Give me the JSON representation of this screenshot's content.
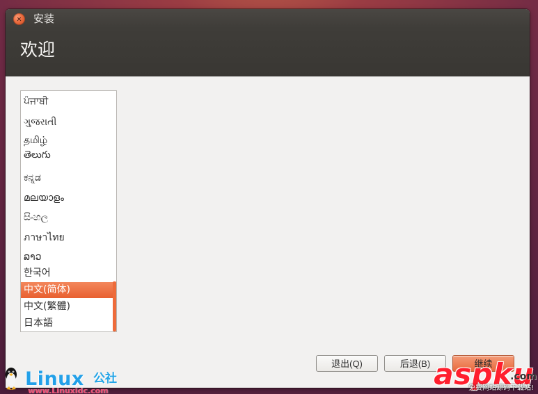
{
  "window": {
    "title": "安装",
    "page_title": "欢迎"
  },
  "languages": {
    "items": [
      "ਪੰਜਾਬੀ",
      "ગુજરાતી",
      "தமிழ்",
      "తెలుగు",
      "ಕನ್ನಡ",
      "മലയാളം",
      "සිංහල",
      "ภาษาไทย",
      "ລາວ",
      "한국어",
      "中文(简体)",
      "中文(繁體)",
      "日本語"
    ],
    "selected": "中文(简体)"
  },
  "buttons": {
    "quit": "退出(Q)",
    "back": "后退(B)",
    "next": "继续"
  },
  "watermarks": {
    "left_brand": "Linux",
    "left_brand_cn": "公社",
    "left_url": "www.Linuxidc.com",
    "right_brand": "aspku",
    "right_tld": ".com",
    "right_sub": "免费网站源码下载站!"
  },
  "colors": {
    "accent": "#e85f2f",
    "title_bar": "#3f3d39",
    "background": "#f2f1f0"
  },
  "icons": {
    "close": "close-icon",
    "tux": "tux-icon"
  }
}
